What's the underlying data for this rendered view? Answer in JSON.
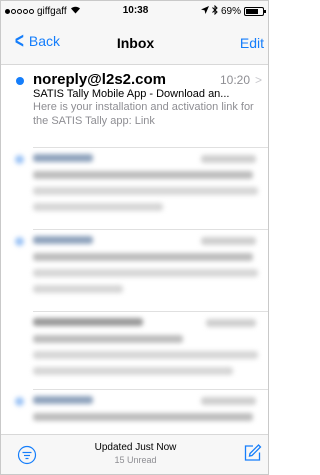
{
  "status_bar": {
    "carrier": "giffgaff",
    "time": "10:38",
    "battery": "69%",
    "battery_level": 0.69,
    "signal_bars_filled": 1,
    "signal_bars_total": 5
  },
  "nav": {
    "back_label": "Back",
    "title": "Inbox",
    "edit_label": "Edit"
  },
  "message": {
    "sender": "noreply@l2s2.com",
    "time": "10:20",
    "subject": "SATIS Tally Mobile App - Download an...",
    "preview": "Here is your installation and activation link for the SATIS Tally app: Link",
    "unread": true
  },
  "toolbar": {
    "status_main": "Updated Just Now",
    "status_sub": "15 Unread"
  },
  "colors": {
    "accent": "#157efb",
    "secondary_text": "#8e8e93"
  },
  "icons": {
    "filter": "filter-icon",
    "compose": "compose-icon",
    "wifi": "wifi-icon",
    "bluetooth": "bluetooth-icon",
    "location": "location-arrow-icon",
    "battery": "battery-icon"
  }
}
